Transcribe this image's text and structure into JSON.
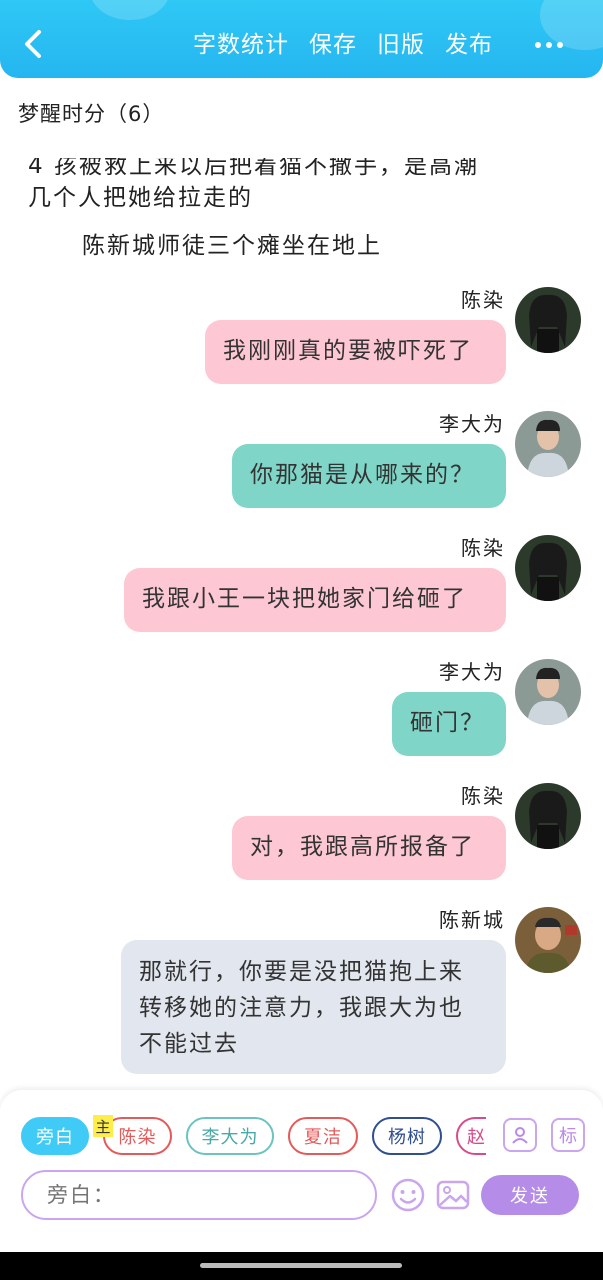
{
  "header": {
    "menu": [
      "字数统计",
      "保存",
      "旧版",
      "发布"
    ]
  },
  "chapter": {
    "title": "梦醒时分（6）"
  },
  "narration": [
    "4 孩被救上来以后把着猫不撒手，是高潮",
    "几个人把她给拉走的",
    "陈新城师徒三个瘫坐在地上"
  ],
  "messages": [
    {
      "speaker": "陈染",
      "text": "我刚刚真的要被吓死了",
      "color": "pink"
    },
    {
      "speaker": "李大为",
      "text": "你那猫是从哪来的？",
      "color": "teal"
    },
    {
      "speaker": "陈染",
      "text": "我跟小王一块把她家门给砸了",
      "color": "pink"
    },
    {
      "speaker": "李大为",
      "text": "砸门？",
      "color": "teal"
    },
    {
      "speaker": "陈染",
      "text": "对，我跟高所报备了",
      "color": "pink"
    },
    {
      "speaker": "陈新城",
      "text": "那就行，你要是没把猫抱上来转移她的注意力，我跟大为也不能过去",
      "color": "gray"
    }
  ],
  "roles": [
    {
      "name": "旁白",
      "active": true,
      "color": "#3fcbf6"
    },
    {
      "name": "陈染",
      "badge": "主",
      "color": "#e45a5a"
    },
    {
      "name": "李大为",
      "color": "#6cc3c0"
    },
    {
      "name": "夏洁",
      "color": "#e45a5a"
    },
    {
      "name": "杨树",
      "color": "#2f4f8f"
    },
    {
      "name": "赵",
      "color": "#d84a8a"
    }
  ],
  "input": {
    "placeholder": "旁白："
  },
  "send_label": "发送",
  "icons": {
    "back": "chevron-left-icon",
    "more": "more-dots-icon",
    "role": "person-card-icon",
    "tag": "tag-label-icon",
    "emoji": "smile-icon",
    "image": "image-icon"
  },
  "tag_icon_label": "标",
  "colors": {
    "header": "#2fc8f5",
    "pink_bubble": "#fdc8d4",
    "teal_bubble": "#7fd6c8",
    "gray_bubble": "#e1e6ef",
    "accent_purple": "#b58ce8"
  }
}
